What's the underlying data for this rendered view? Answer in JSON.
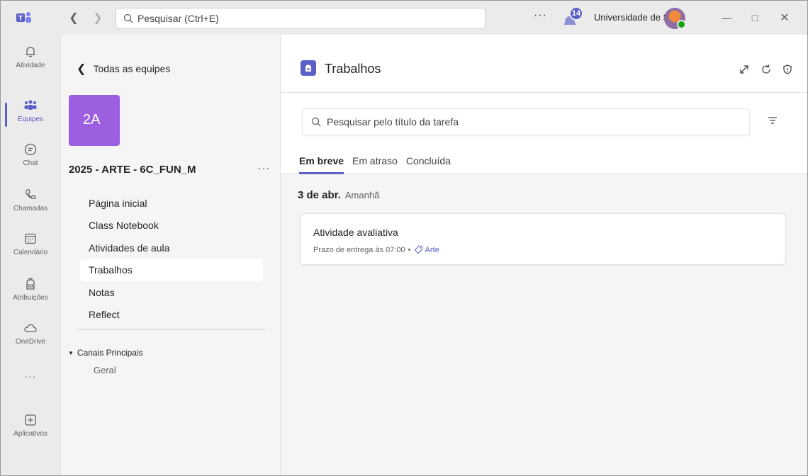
{
  "titlebar": {
    "search_placeholder": "Pesquisar (Ctrl+E)",
    "more": "···",
    "notifications_count": "14",
    "org_name": "Universidade de S..."
  },
  "rail": {
    "items": [
      {
        "label": "Atividade",
        "icon": "bell-icon"
      },
      {
        "label": "Equipes",
        "icon": "teams-icon",
        "active": true
      },
      {
        "label": "Chat",
        "icon": "chat-icon"
      },
      {
        "label": "Chamadas",
        "icon": "phone-icon"
      },
      {
        "label": "Calendário",
        "icon": "calendar-icon"
      },
      {
        "label": "Atribuições",
        "icon": "backpack-icon"
      },
      {
        "label": "OneDrive",
        "icon": "cloud-icon"
      },
      {
        "label": "···",
        "icon": "more-icon"
      },
      {
        "label": "Aplicativos",
        "icon": "add-app-icon"
      }
    ]
  },
  "team_panel": {
    "back_label": "Todas as equipes",
    "avatar_text": "2A",
    "team_name": "2025 - ARTE - 6C_FUN_M",
    "more": "···",
    "nav": [
      "Página inicial",
      "Class Notebook",
      "Atividades de aula",
      "Trabalhos",
      "Notas",
      "Reflect"
    ],
    "active_index": 3,
    "channels_header": "Canais Principais",
    "channels": [
      "Geral"
    ]
  },
  "main": {
    "title": "Trabalhos",
    "search_placeholder": "Pesquisar pelo título da tarefa",
    "tabs": [
      "Em breve",
      "Em atraso",
      "Concluída"
    ],
    "active_tab": 0,
    "date": "3 de abr.",
    "date_relative": "Amanhã",
    "task": {
      "title": "Atividade avaliativa",
      "due": "Prazo de entrega às 07:00",
      "separator": "•",
      "tag": "Arte"
    }
  },
  "colors": {
    "accent": "#5b5fc7",
    "team_avatar": "#9b5fe0",
    "presence": "#13a10e"
  }
}
